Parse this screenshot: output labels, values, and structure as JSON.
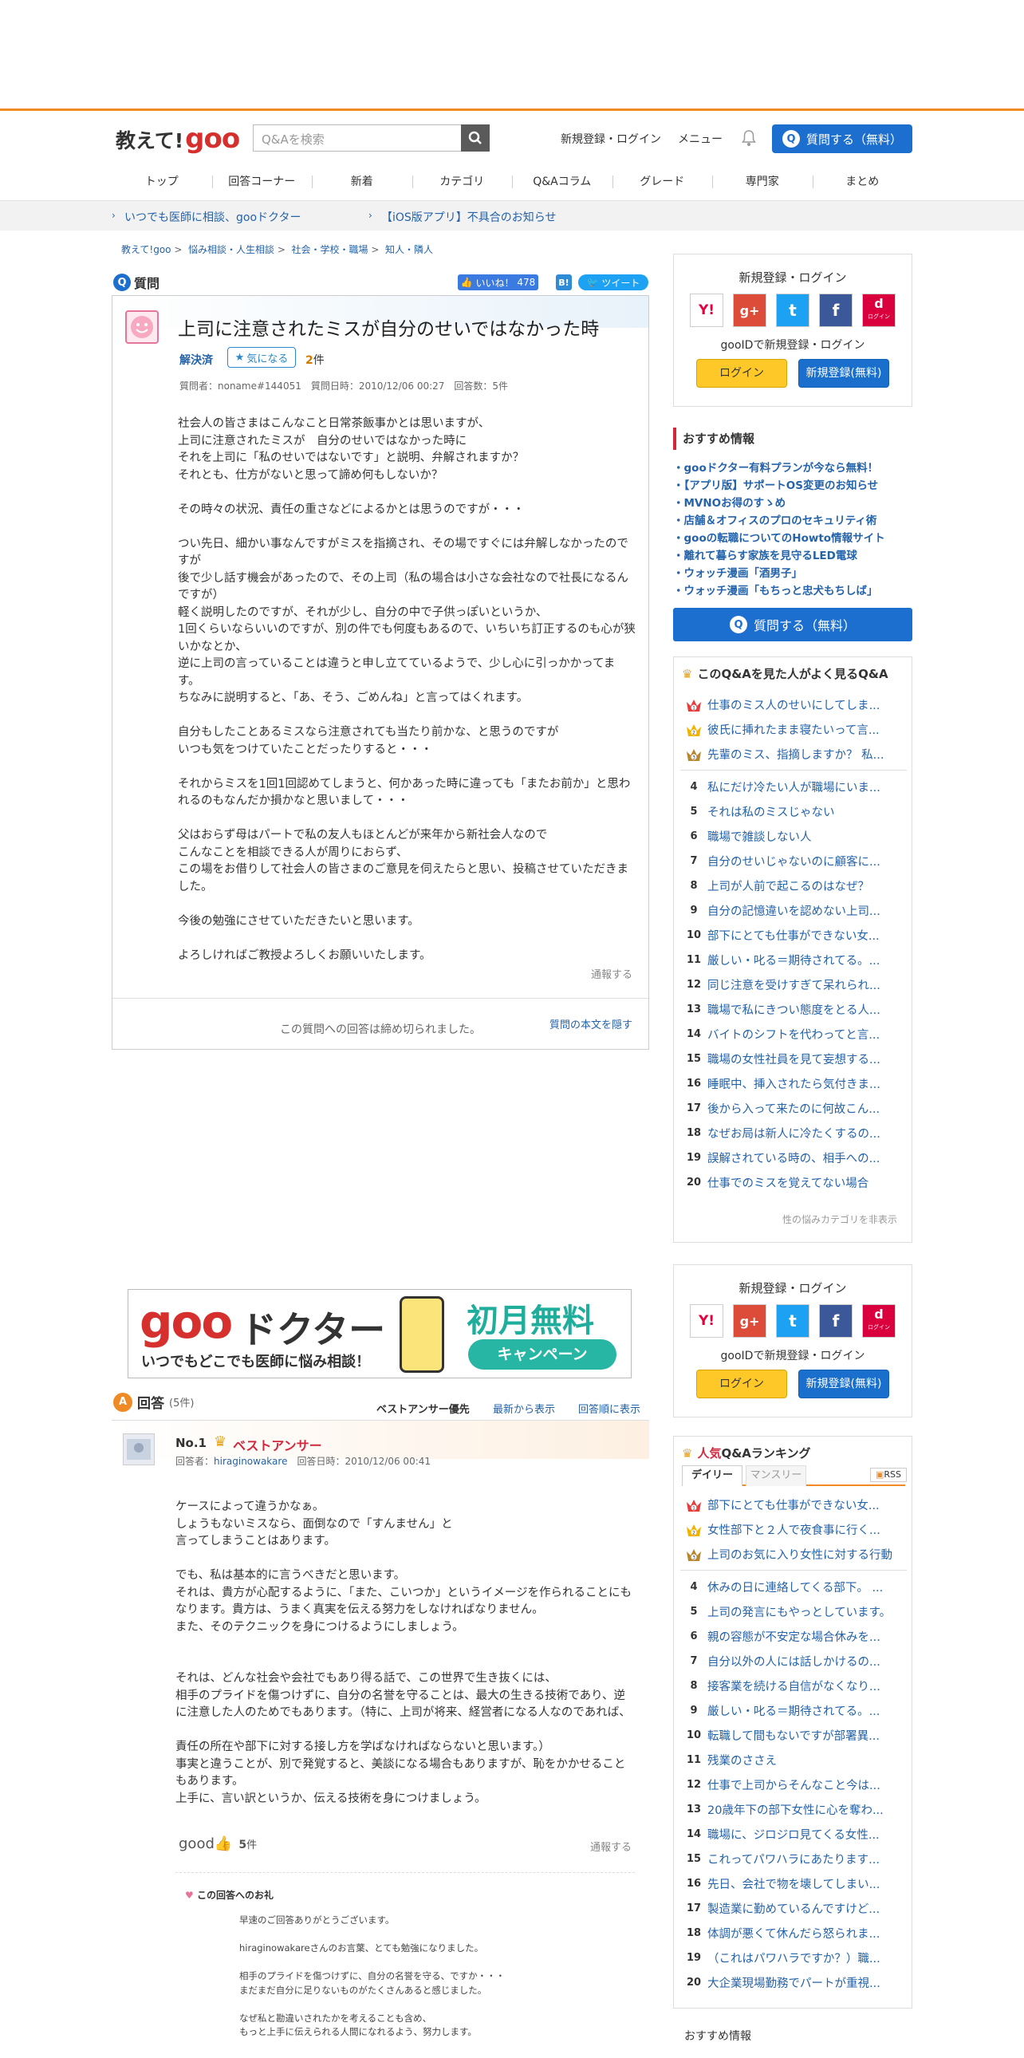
{
  "header": {
    "logo_text": "教えて!",
    "logo_brand": "goo",
    "search_placeholder": "Q&Aを検索",
    "signup": "新規登録・ログイン",
    "menu": "メニュー",
    "ask": "質問する（無料）"
  },
  "nav": [
    "トップ",
    "回答コーナー",
    "新着",
    "カテゴリ",
    "Q&Aコラム",
    "グレード",
    "専門家",
    "まとめ"
  ],
  "notice": {
    "left": "いつでも医師に相談、gooドクター",
    "right": "【iOS版アプリ】不具合のお知らせ"
  },
  "breadcrumbs": [
    "教えて!goo",
    "悩み相談・人生相談",
    "社会・学校・職場",
    "知人・隣人"
  ],
  "question": {
    "section_label": "質問",
    "like_label": "いいね！",
    "like_count": "478",
    "hatena": "B!",
    "tweet": "ツイート",
    "title": "上司に注意されたミスが自分のせいではなかった時",
    "status": "解決済",
    "fav_label": "気になる",
    "fav_count": "2",
    "fav_unit": "件",
    "meta": "質問者：noname#144051　質問日時：2010/12/06 00:27　回答数：5件",
    "body": "社会人の皆さまはこんなこと日常茶飯事かとは思いますが、\n上司に注意されたミスが　自分のせいではなかった時に\nそれを上司に「私のせいではないです」と説明、弁解されますか？\nそれとも、仕方がないと思って諦め何もしないか？\n\nその時々の状況、責任の重さなどによるかとは思うのですが・・・\n\nつい先日、細かい事なんですがミスを指摘され、その場ですぐには弁解しなかったのですが\n後で少し話す機会があったので、その上司（私の場合は小さな会社なので社長になるんですが）\n軽く説明したのですが、それが少し、自分の中で子供っぽいというか、\n1回くらいならいいのですが、別の件でも何度もあるので、いちいち訂正するのも心が狭いかなとか、\n逆に上司の言っていることは違うと申し立てているようで、少し心に引っかかってます。\nちなみに説明すると、「あ、そう、ごめんね」と言ってはくれます。\n\n自分もしたことあるミスなら注意されても当たり前かな、と思うのですが\nいつも気をつけていたことだったりすると・・・\n\nそれからミスを1回1回認めてしまうと、何かあった時に違っても「またお前か」と思われるのもなんだか損かなと思いまして・・・\n\n父はおらず母はパートで私の友人もほとんどが来年から新社会人なので\nこんなことを相談できる人が周りにおらず、\nこの場をお借りして社会人の皆さまのご意見を伺えたらと思い、投稿させていただきました。\n\n今後の勉強にさせていただきたいと思います。\n\nよろしければご教授よろしくお願いいたします。",
    "report": "通報する",
    "closed": "この質問への回答は締め切られました。",
    "hide": "質問の本文を隠す"
  },
  "login_box": {
    "title": "新規登録・ログイン",
    "goo_id": "gooIDで新規登録・ログイン",
    "login": "ログイン",
    "register": "新規登録(無料)",
    "social": [
      "Y!",
      "g+",
      "t",
      "f",
      "d"
    ],
    "docomo_small": "ログイン"
  },
  "recommend": {
    "title": "おすすめ情報",
    "items": [
      "gooドクター有料プランが今なら無料！",
      "【アプリ版】サポートOS変更のお知らせ",
      "MVNOお得のすゝめ",
      "店舗＆オフィスのプロのセキュリティ術",
      "gooの転職についてのHowto情報サイト",
      "離れて暮らす家族を見守るLED電球",
      "ウォッチ漫画「酒男子」",
      "ウォッチ漫画「もちっと忠犬もちしば」"
    ],
    "ask": "質問する（無料）"
  },
  "related": {
    "title": "このQ&Aを見た人がよく見るQ&A",
    "items": [
      "仕事のミス人のせいにしてしま...",
      "彼氏に挿れたまま寝たいって言...",
      "先輩のミス、指摘しますか？ 私...",
      "私にだけ冷たい人が職場にいま...",
      "それは私のミスじゃない",
      "職場で雑談しない人",
      "自分のせいじゃないのに顧客に...",
      "上司が人前で起こるのはなぜ？",
      "自分の記憶違いを認めない上司...",
      "部下にとても仕事ができない女...",
      "厳しい・叱る＝期待されてる。...",
      "同じ注意を受けすぎて呆れられ...",
      "職場で私にきつい態度をとる人...",
      "バイトのシフトを代わってと言...",
      "職場の女性社員を見て妄想する...",
      "睡眠中、挿入されたら気付きま...",
      "後から入って来たのに何故こん...",
      "なぜお局は新人に冷たくするの...",
      "誤解されている時の、相手への...",
      "仕事でのミスを覚えてない場合"
    ],
    "hide": "性の悩みカテゴリを非表示"
  },
  "ad": {
    "brand": "goo",
    "title": "ドクター",
    "tag": "いつでもどこでも医師に悩み相談！",
    "promo": "初月無料",
    "campaign": "キャンペーン"
  },
  "answers": {
    "label": "回答",
    "count": "(5件)",
    "sort": [
      "ベストアンサー優先",
      "最新から表示",
      "回答順に表示"
    ]
  },
  "answer1": {
    "no": "No.1",
    "best": "ベストアンサー",
    "meta_prefix": "回答者：",
    "user": "hiraginowakare",
    "date": "　回答日時：2010/12/06 00:41",
    "body": "ケースによって違うかなぁ。\nしょうもないミスなら、面倒なので「すんません」と\n言ってしまうことはあります。\n\nでも、私は基本的に言うべきだと思います。\nそれは、貴方が心配するように、「また、こいつか」というイメージを作られることにもなります。貴方は、うまく真実を伝える努力をしなければなりません。\nまた、そのテクニックを身につけるようにしましょう。\n\n\nそれは、どんな社会や会社でもあり得る話で、この世界で生き抜くには、\n相手のプライドを傷つけずに、自分の名誉を守ることは、最大の生きる技術であり、逆に注意した人のためでもあります。（特に、上司が将来、経営者になる人なのであれば、\n\n責任の所在や部下に対する接し方を学ばなければならないと思います。）\n事実と違うことが、別で発覚すると、美談になる場合もありますが、恥をかかせることもあります。\n上手に、言い訳というか、伝える技術を身につけましょう。",
    "good": "good",
    "good_count": "5",
    "good_unit": "件",
    "report": "通報する",
    "thanks_title": "この回答へのお礼",
    "thanks": "早速のご回答ありがとうございます。\n\nhiraginowakareさんのお言葉、とても勉強になりました。\n\n相手のプライドを傷つけずに、自分の名誉を守る、ですか・・・\nまだまだ自分に足りないものがたくさんあると感じました。\n\nなぜ私と勘違いされたかを考えることも含め、\nもっと上手に伝えられる人間になれるよう、努力します。"
  },
  "ranking": {
    "title_em": "人気",
    "title": "Q&Aランキング",
    "tabs": [
      "デイリー",
      "マンスリー"
    ],
    "rss": "RSS",
    "items": [
      "部下にとても仕事ができない女...",
      "女性部下と２人で夜食事に行く...",
      "上司のお気に入り女性に対する行動",
      "休みの日に連絡してくる部下。 ...",
      "上司の発言にもやっとしています。",
      "親の容態が不安定な場合休みを...",
      "自分以外の人には話しかけるの...",
      "接客業を続ける自信がなくなり...",
      "厳しい・叱る＝期待されてる。...",
      "転職して間もないですが部署異...",
      "残業のささえ",
      "仕事で上司からそんなこと今は...",
      "20歳年下の部下女性に心を奪わ...",
      "職場に、ジロジロ見てくる女性...",
      "これってパワハラにあたります...",
      "先日、会社で物を壊してしまい...",
      "製造業に勤めているんですけど...",
      "体調が悪くて休んだら怒られま...",
      "（これはパワハラですか？）職...",
      "大企業現場勤務でパートが重視..."
    ]
  },
  "recommend2": {
    "title": "おすすめ情報"
  },
  "colors": {
    "accent": "#f08a24",
    "blue": "#1c6fce",
    "link": "#2462a9",
    "brand": "#d5302d"
  }
}
